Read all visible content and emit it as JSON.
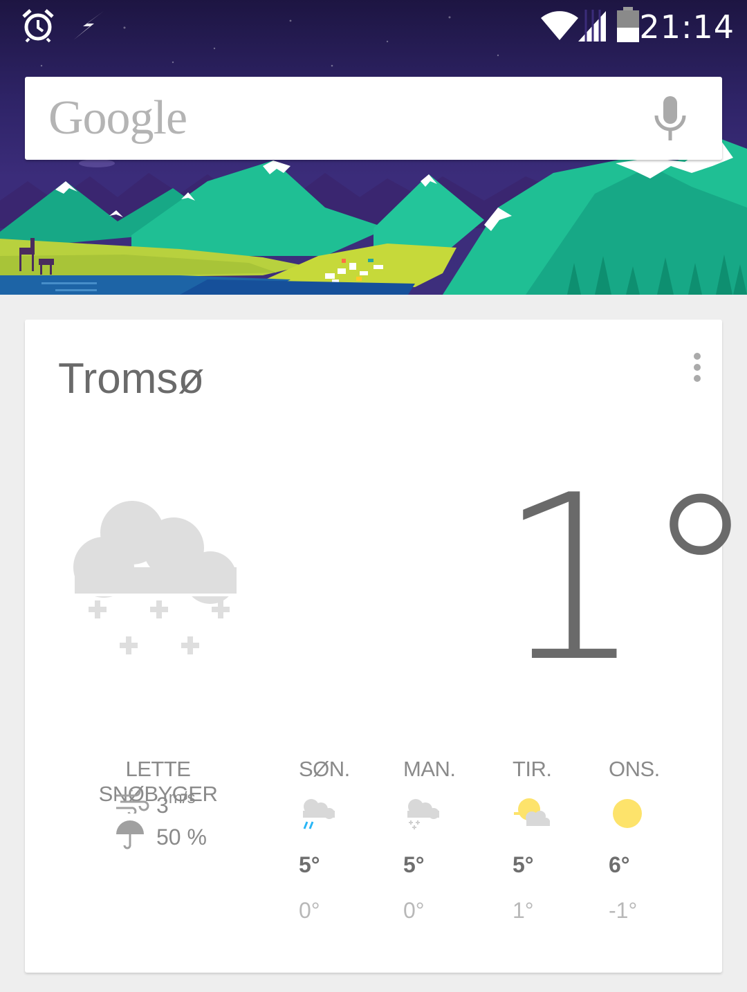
{
  "status_bar": {
    "time": "21:14",
    "icons": [
      "alarm-icon",
      "flash-icon",
      "wifi-icon",
      "signal-icon",
      "battery-icon"
    ]
  },
  "search": {
    "logo_text": "Google",
    "voice_icon": "mic-icon"
  },
  "weather": {
    "city": "Tromsø",
    "temperature": "1°",
    "current_icon": "cloud-snow-icon",
    "condition": "LETTE SNØBYGER",
    "wind": {
      "value": "3",
      "unit": "m/s",
      "icon": "wind-icon"
    },
    "precipitation": {
      "value": "50 %",
      "icon": "umbrella-icon"
    },
    "forecast": [
      {
        "day": "SØN.",
        "icon": "cloud-rain-icon",
        "high": "5°",
        "low": "0°"
      },
      {
        "day": "MAN.",
        "icon": "cloud-snow-small-icon",
        "high": "5°",
        "low": "0°"
      },
      {
        "day": "TIR.",
        "icon": "partly-sunny-icon",
        "high": "5°",
        "low": "1°"
      },
      {
        "day": "ONS.",
        "icon": "sun-icon",
        "high": "6°",
        "low": "-1°"
      }
    ]
  },
  "colors": {
    "sky": "#2f2468",
    "mountain": "#1fbf94",
    "meadow": "#c6d93a",
    "water": "#1e6aa8",
    "sun": "#fde36b",
    "text": "#6a6a6a"
  }
}
